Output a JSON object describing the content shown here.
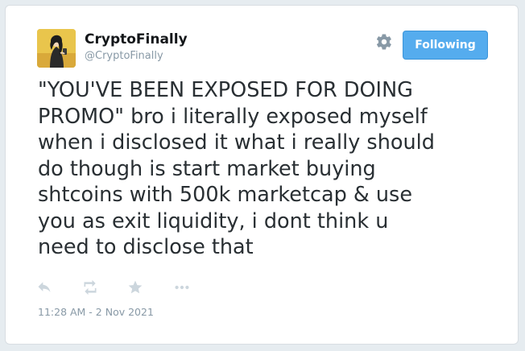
{
  "tweet": {
    "author": {
      "display_name": "CryptoFinally",
      "handle": "@CryptoFinally",
      "avatar_icon": "avatar-illustration"
    },
    "follow_button_label": "Following",
    "text": "\"YOU'VE BEEN EXPOSED FOR DOING\nPROMO\" bro i literally exposed myself\nwhen i disclosed it what i really should\ndo though is start market buying\nshtcoins with 500k marketcap & use\nyou as exit liquidity, i dont think u\nneed to disclose that",
    "timestamp": "11:28 AM - 2 Nov 2021",
    "actions": [
      "reply-icon",
      "retweet-icon",
      "favorite-icon",
      "more-icon"
    ]
  },
  "colors": {
    "accent": "#55acee",
    "text": "#292f33",
    "muted": "#8899a6",
    "icon": "#ccd6dd"
  }
}
